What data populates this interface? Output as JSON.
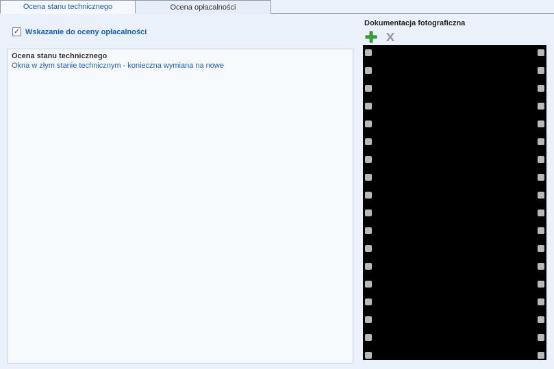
{
  "tabs": {
    "active": "Ocena stanu technicznego",
    "inactive": "Ocena opłacalności"
  },
  "checkbox": {
    "checked_glyph": "✓",
    "label": "Wskazanie do oceny opłacalności"
  },
  "assessment": {
    "title": "Ocena stanu technicznego",
    "text": "Okna w złym stanie technicznym - konieczna wymiana na nowe"
  },
  "documentation": {
    "title": "Dokumentacja fotograficzna"
  }
}
